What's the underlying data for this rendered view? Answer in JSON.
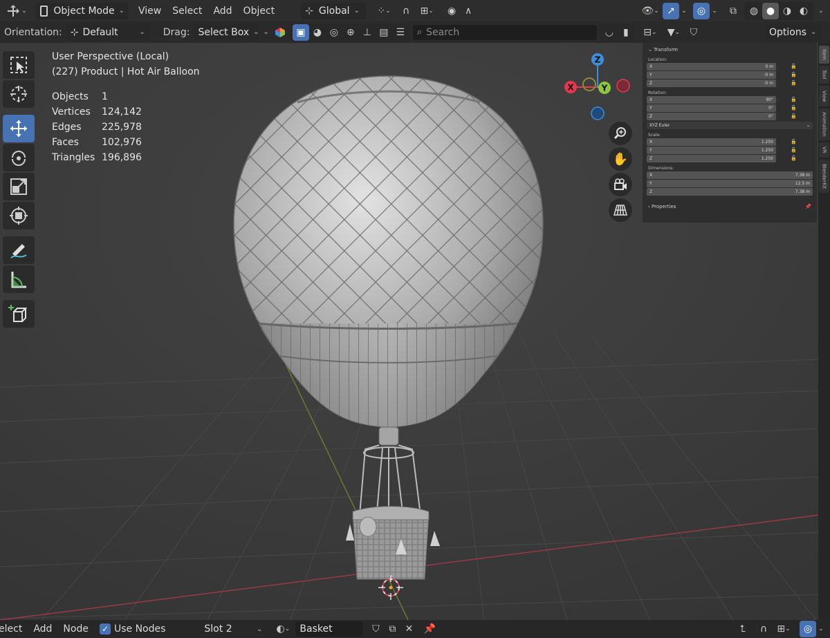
{
  "header": {
    "editor_type_icon": "transform-gizmo-icon",
    "mode": "Object Mode",
    "menus": [
      "View",
      "Select",
      "Add",
      "Object"
    ],
    "transform_orientation": "Global"
  },
  "tool_header": {
    "orientation_label": "Orientation:",
    "orientation_value": "Default",
    "drag_label": "Drag:",
    "drag_value": "Select Box",
    "search_placeholder": "Search",
    "options_label": "Options"
  },
  "viewport": {
    "view_name": "User Perspective (Local)",
    "object_info": "(227) Product | Hot Air Balloon",
    "stats": [
      {
        "label": "Objects",
        "value": "1"
      },
      {
        "label": "Vertices",
        "value": "124,142"
      },
      {
        "label": "Edges",
        "value": "225,978"
      },
      {
        "label": "Faces",
        "value": "102,976"
      },
      {
        "label": "Triangles",
        "value": "196,896"
      }
    ],
    "gizmo": {
      "x": "X",
      "y": "Y",
      "z": "Z"
    }
  },
  "npanel": {
    "title": "Transform",
    "location_label": "Location:",
    "location": [
      {
        "axis": "X",
        "value": "0 m"
      },
      {
        "axis": "Y",
        "value": "-0 m"
      },
      {
        "axis": "Z",
        "value": "-0 m"
      }
    ],
    "rotation_label": "Rotation:",
    "rotation": [
      {
        "axis": "X",
        "value": "90°"
      },
      {
        "axis": "Y",
        "value": "0°"
      },
      {
        "axis": "Z",
        "value": "0°"
      }
    ],
    "rotation_mode": "XYZ Euler",
    "scale_label": "Scale:",
    "scale": [
      {
        "axis": "X",
        "value": "1.250"
      },
      {
        "axis": "Y",
        "value": "1.250"
      },
      {
        "axis": "Z",
        "value": "1.250"
      }
    ],
    "dimensions_label": "Dimensions:",
    "dimensions": [
      {
        "axis": "X",
        "value": "7.38 m"
      },
      {
        "axis": "Y",
        "value": "12.5 m"
      },
      {
        "axis": "Z",
        "value": "7.38 m"
      }
    ],
    "properties_label": "Properties",
    "tabs": [
      "Item",
      "Tool",
      "View",
      "Animation",
      "VR",
      "BlenderKit"
    ]
  },
  "footer": {
    "menus": [
      "elect",
      "Add",
      "Node"
    ],
    "use_nodes_label": "Use Nodes",
    "use_nodes_checked": true,
    "slot": "Slot 2",
    "material": "Basket"
  },
  "colors": {
    "accent": "#4772b3",
    "axis_x": "#e8384f",
    "axis_y": "#8cc63f",
    "axis_z": "#3d8ed8",
    "panel_bg": "#2d2d2d",
    "viewport_bg": "#3b3b3b"
  }
}
